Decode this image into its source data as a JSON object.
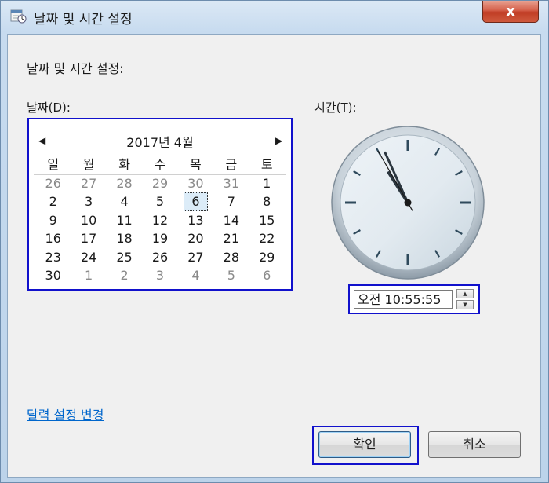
{
  "window": {
    "title": "날짜 및 시간 설정",
    "close_label": "x"
  },
  "main": {
    "heading": "날짜 및 시간 설정:",
    "date_label": "날짜(D):",
    "time_label": "시간(T):"
  },
  "calendar": {
    "prev_label": "◀",
    "next_label": "▶",
    "month_title": "2017년 4월",
    "weekdays": [
      "일",
      "월",
      "화",
      "수",
      "목",
      "금",
      "토"
    ],
    "weeks": [
      [
        "26",
        "27",
        "28",
        "29",
        "30",
        "31",
        "1"
      ],
      [
        "2",
        "3",
        "4",
        "5",
        "6",
        "7",
        "8"
      ],
      [
        "9",
        "10",
        "11",
        "12",
        "13",
        "14",
        "15"
      ],
      [
        "16",
        "17",
        "18",
        "19",
        "20",
        "21",
        "22"
      ],
      [
        "23",
        "24",
        "25",
        "26",
        "27",
        "28",
        "29"
      ],
      [
        "30",
        "1",
        "2",
        "3",
        "4",
        "5",
        "6"
      ]
    ],
    "selected_day": "6"
  },
  "clock": {
    "hour": 10,
    "minute": 55,
    "second": 55
  },
  "time_field": {
    "value": "오전 10:55:55"
  },
  "footer": {
    "calendar_link": "달력 설정 변경",
    "ok_label": "확인",
    "cancel_label": "취소"
  },
  "colors": {
    "highlight_border": "#1111cc",
    "link": "#0066cc"
  }
}
